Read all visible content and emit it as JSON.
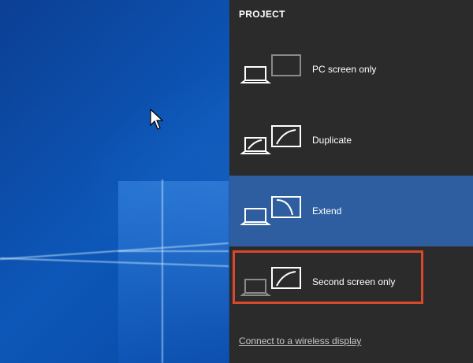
{
  "panel": {
    "title": "PROJECT",
    "options": [
      {
        "label": "PC screen only",
        "icon": "pc-screen-only-icon",
        "selected": false
      },
      {
        "label": "Duplicate",
        "icon": "duplicate-icon",
        "selected": false
      },
      {
        "label": "Extend",
        "icon": "extend-icon",
        "selected": true
      },
      {
        "label": "Second screen only",
        "icon": "second-screen-only-icon",
        "selected": false
      }
    ],
    "connect_link": "Connect to a wireless display"
  },
  "colors": {
    "panel_bg": "#2b2b2b",
    "selected_bg": "#2e5e9f",
    "highlight_border": "#d9482b",
    "desktop_blue": "#0d57b8"
  }
}
